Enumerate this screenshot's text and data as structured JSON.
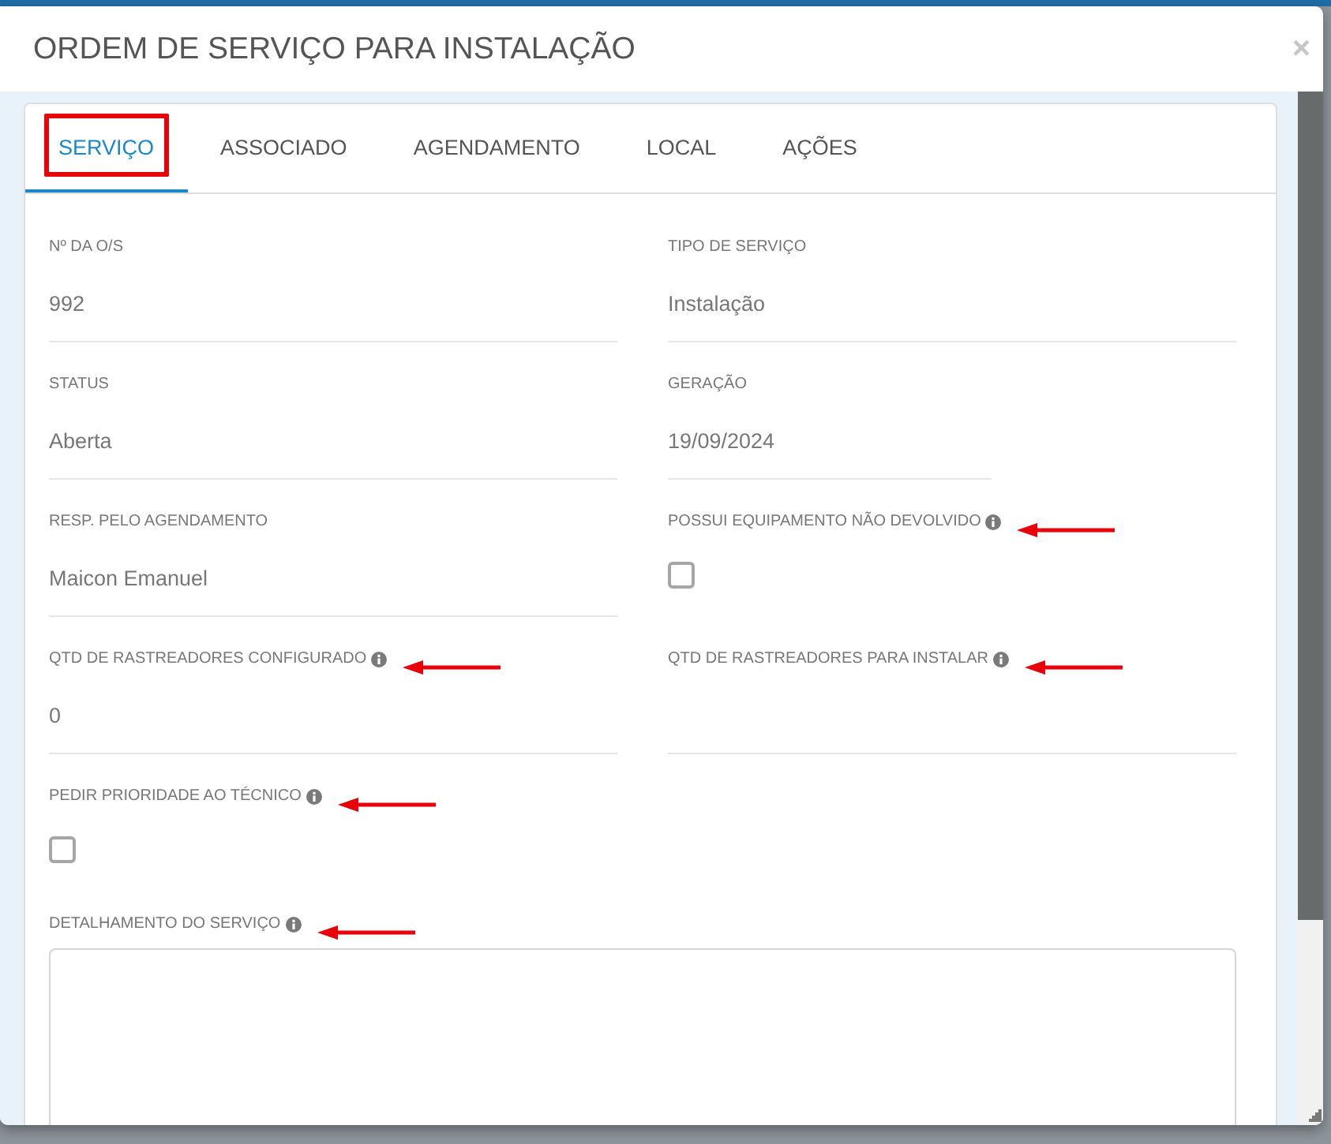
{
  "modal": {
    "title": "ORDEM DE SERVIÇO PARA INSTALAÇÃO",
    "close": "×"
  },
  "tabs": [
    {
      "label": "SERVIÇO",
      "selected": true,
      "outlined": true
    },
    {
      "label": "ASSOCIADO",
      "selected": false,
      "outlined": false
    },
    {
      "label": "AGENDAMENTO",
      "selected": false,
      "outlined": false
    },
    {
      "label": "LOCAL",
      "selected": false,
      "outlined": false
    },
    {
      "label": "AÇÕES",
      "selected": false,
      "outlined": false
    }
  ],
  "rows": [
    {
      "fields": [
        {
          "kind": "text",
          "label": "Nº DA O/S",
          "value": "992",
          "info": false,
          "arrow": false
        },
        {
          "kind": "text",
          "label": "TIPO DE SERVIÇO",
          "value": "Instalação",
          "info": false,
          "arrow": false
        }
      ]
    },
    {
      "fields": [
        {
          "kind": "text",
          "label": "STATUS",
          "value": "Aberta",
          "info": false,
          "arrow": false
        },
        {
          "kind": "date",
          "label": "GERAÇÃO",
          "value": "19/09/2024",
          "info": false,
          "arrow": false
        }
      ]
    },
    {
      "fields": [
        {
          "kind": "text",
          "label": "RESP. PELO AGENDAMENTO",
          "value": "Maicon Emanuel",
          "info": false,
          "arrow": false
        },
        {
          "kind": "checkbox",
          "label": "POSSUI EQUIPAMENTO NÃO DEVOLVIDO",
          "checked": false,
          "info": true,
          "arrow": true
        }
      ]
    },
    {
      "fields": [
        {
          "kind": "text",
          "label": "QTD DE RASTREADORES CONFIGURADO",
          "value": "0",
          "info": true,
          "arrow": true
        },
        {
          "kind": "text",
          "label": "QTD DE RASTREADORES PARA INSTALAR",
          "info": true,
          "arrow": true
        }
      ]
    },
    {
      "fields": [
        {
          "kind": "checkbox",
          "label": "PEDIR PRIORIDADE AO TÉCNICO",
          "checked": false,
          "info": true,
          "arrow": true
        }
      ]
    },
    {
      "fields": [
        {
          "kind": "textarea",
          "label": "DETALHAMENTO DO SERVIÇO",
          "info": true,
          "arrow": true
        }
      ]
    }
  ]
}
